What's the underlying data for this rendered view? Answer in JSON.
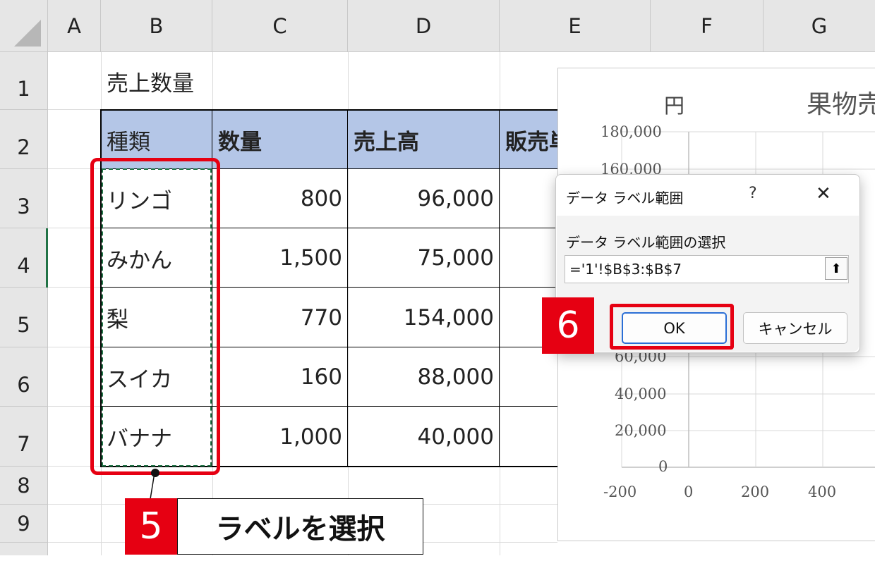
{
  "sheet": {
    "columns": [
      "A",
      "B",
      "C",
      "D",
      "E",
      "F",
      "G"
    ],
    "rows": [
      "1",
      "2",
      "3",
      "4",
      "5",
      "6",
      "7",
      "8",
      "9"
    ],
    "title": "売上数量",
    "headers": [
      "種類",
      "数量",
      "売上高",
      "販売単"
    ],
    "data": [
      [
        "リンゴ",
        "800",
        "96,000"
      ],
      [
        "みかん",
        "1,500",
        "75,000"
      ],
      [
        "梨",
        "770",
        "154,000"
      ],
      [
        "スイカ",
        "160",
        "88,000"
      ],
      [
        "バナナ",
        "1,000",
        "40,000"
      ]
    ]
  },
  "chart": {
    "title": "果物売",
    "y_unit": "円",
    "y_ticks": [
      "180,000",
      "160,000",
      "60,000",
      "40,000",
      "20,000",
      "0"
    ],
    "x_ticks": [
      "-200",
      "0",
      "200",
      "400"
    ]
  },
  "dialog": {
    "title": "データ ラベル範囲",
    "help": "?",
    "close": "✕",
    "label": "データ ラベル範囲の選択",
    "range_value": "='1'!$B$3:$B$7",
    "collapse": "⬆",
    "ok": "OK",
    "cancel": "キャンセル"
  },
  "callouts": {
    "step5_number": "5",
    "step5_text": "ラベルを選択",
    "step6_number": "6"
  },
  "colors": {
    "highlight": "#e60012",
    "header_fill": "#b4c6e7",
    "marquee": "#217346"
  }
}
